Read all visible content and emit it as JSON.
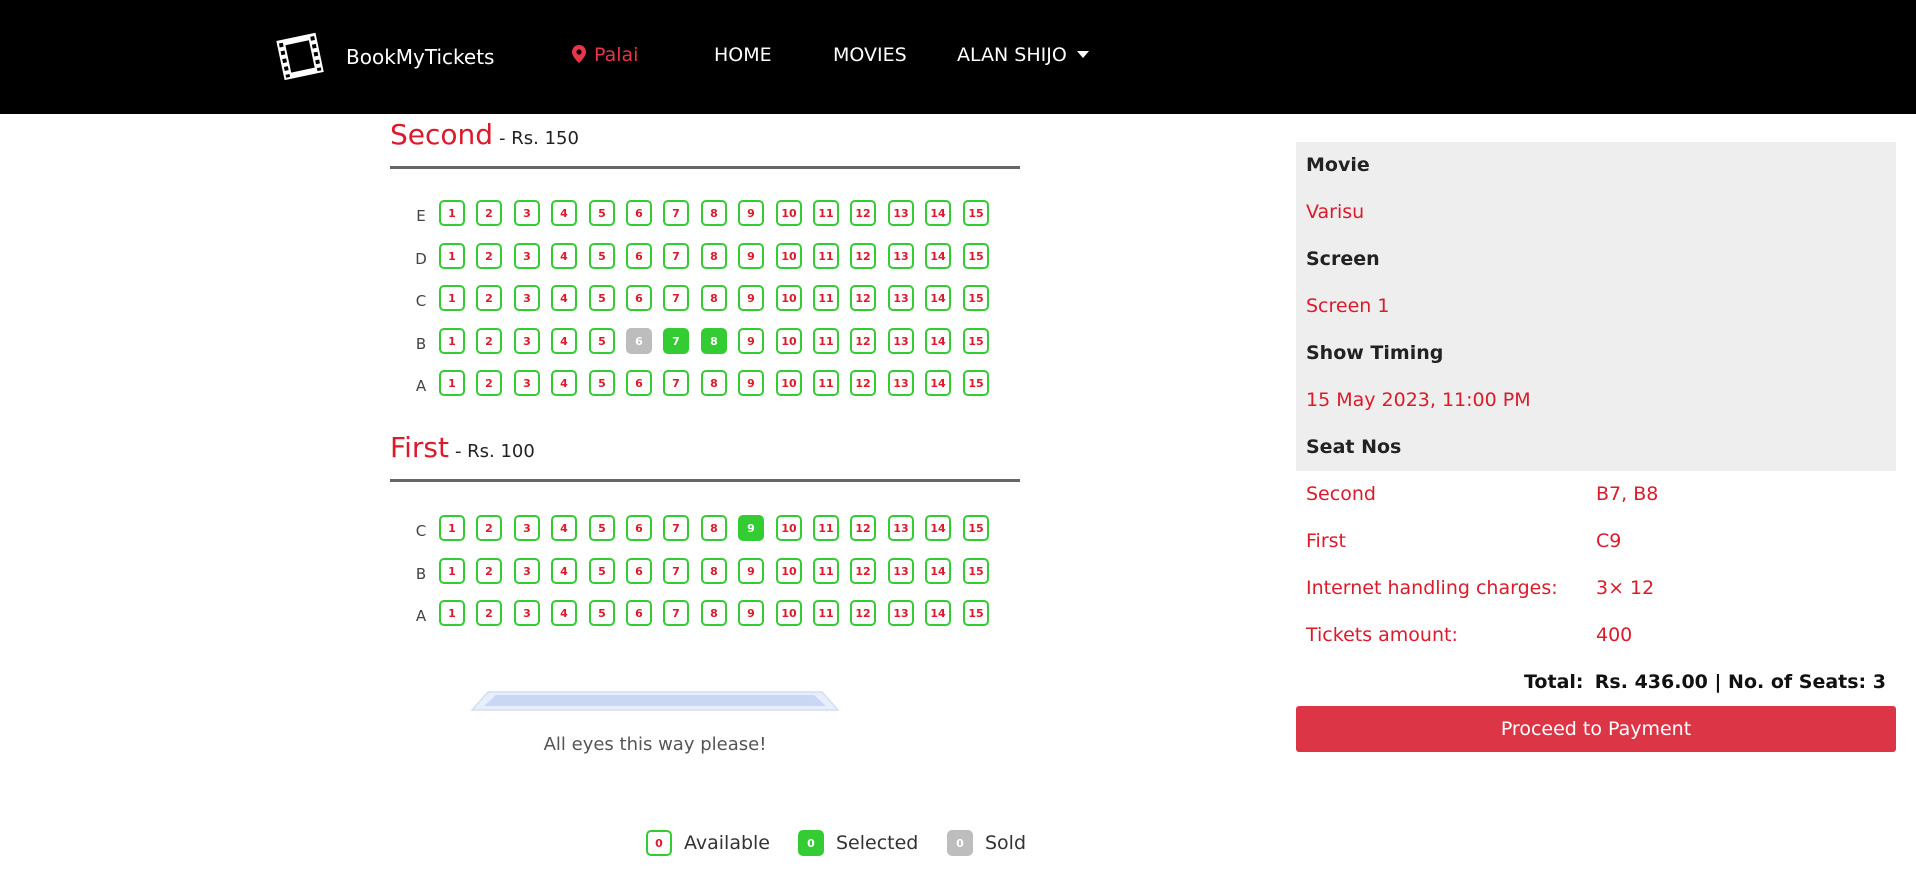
{
  "nav": {
    "brand": "BookMyTickets",
    "location": "Palai",
    "home": "HOME",
    "movies": "MOVIES",
    "user": "ALAN SHIJO"
  },
  "sections": [
    {
      "name": "Second",
      "price": "- Rs. 150",
      "rows": [
        {
          "label": "E",
          "seats": [
            "1",
            "2",
            "3",
            "4",
            "5",
            "6",
            "7",
            "8",
            "9",
            "10",
            "11",
            "12",
            "13",
            "14",
            "15"
          ],
          "selected": [],
          "sold": []
        },
        {
          "label": "D",
          "seats": [
            "1",
            "2",
            "3",
            "4",
            "5",
            "6",
            "7",
            "8",
            "9",
            "10",
            "11",
            "12",
            "13",
            "14",
            "15"
          ],
          "selected": [],
          "sold": []
        },
        {
          "label": "C",
          "seats": [
            "1",
            "2",
            "3",
            "4",
            "5",
            "6",
            "7",
            "8",
            "9",
            "10",
            "11",
            "12",
            "13",
            "14",
            "15"
          ],
          "selected": [],
          "sold": []
        },
        {
          "label": "B",
          "seats": [
            "1",
            "2",
            "3",
            "4",
            "5",
            "6",
            "7",
            "8",
            "9",
            "10",
            "11",
            "12",
            "13",
            "14",
            "15"
          ],
          "selected": [
            "7",
            "8"
          ],
          "sold": [
            "6"
          ]
        },
        {
          "label": "A",
          "seats": [
            "1",
            "2",
            "3",
            "4",
            "5",
            "6",
            "7",
            "8",
            "9",
            "10",
            "11",
            "12",
            "13",
            "14",
            "15"
          ],
          "selected": [],
          "sold": []
        }
      ]
    },
    {
      "name": "First",
      "price": "- Rs. 100",
      "rows": [
        {
          "label": "C",
          "seats": [
            "1",
            "2",
            "3",
            "4",
            "5",
            "6",
            "7",
            "8",
            "9",
            "10",
            "11",
            "12",
            "13",
            "14",
            "15"
          ],
          "selected": [
            "9"
          ],
          "sold": []
        },
        {
          "label": "B",
          "seats": [
            "1",
            "2",
            "3",
            "4",
            "5",
            "6",
            "7",
            "8",
            "9",
            "10",
            "11",
            "12",
            "13",
            "14",
            "15"
          ],
          "selected": [],
          "sold": []
        },
        {
          "label": "A",
          "seats": [
            "1",
            "2",
            "3",
            "4",
            "5",
            "6",
            "7",
            "8",
            "9",
            "10",
            "11",
            "12",
            "13",
            "14",
            "15"
          ],
          "selected": [],
          "sold": []
        }
      ]
    }
  ],
  "screen_text": "All eyes this way please!",
  "legend": {
    "available_num": "0",
    "available": "Available",
    "selected_num": "0",
    "selected": "Selected",
    "sold_num": "0",
    "sold": "Sold"
  },
  "summary": {
    "movie_label": "Movie",
    "movie": "Varisu",
    "screen_label": "Screen",
    "screen": "Screen 1",
    "timing_label": "Show Timing",
    "timing": "15 May 2023, 11:00 PM",
    "seats_label": "Seat Nos",
    "seat_rows": [
      {
        "label": "Second",
        "value": "B7, B8"
      },
      {
        "label": "First",
        "value": "C9"
      },
      {
        "label": "Internet handling charges:",
        "value": "3× 12"
      },
      {
        "label": "Tickets amount:",
        "value": "400"
      }
    ],
    "total_label": "Total:",
    "total_value": "Rs. 436.00 | No. of Seats: 3",
    "pay_button": "Proceed to Payment"
  },
  "colors": {
    "accent_red": "#dc1a2b",
    "seat_green": "#33cc33",
    "sold_grey": "#bdbdbd",
    "button_red": "#dc3545"
  }
}
